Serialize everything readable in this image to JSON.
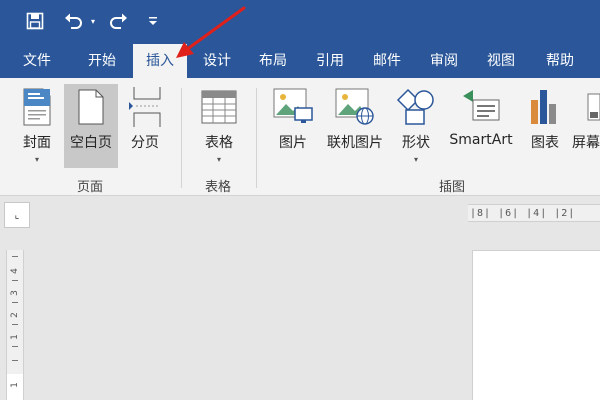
{
  "tabs": [
    {
      "label": "文件"
    },
    {
      "label": "开始"
    },
    {
      "label": "插入"
    },
    {
      "label": "设计"
    },
    {
      "label": "布局"
    },
    {
      "label": "引用"
    },
    {
      "label": "邮件"
    },
    {
      "label": "审阅"
    },
    {
      "label": "视图"
    },
    {
      "label": "帮助"
    }
  ],
  "active_tab": "插入",
  "ribbon": {
    "pages": {
      "group_label": "页面",
      "cover": "封面",
      "blank": "空白页",
      "break": "分页"
    },
    "tables": {
      "group_label": "表格",
      "table": "表格"
    },
    "illustrations": {
      "group_label": "插图",
      "picture": "图片",
      "online_picture": "联机图片",
      "shapes": "形状",
      "smartart": "SmartArt",
      "chart": "图表",
      "screenshot": "屏幕"
    }
  },
  "ruler": {
    "horizontal_text": "|8|  |6|  |4|  |2|",
    "vertical_numbers": [
      "4",
      "3",
      "2",
      "1",
      "1"
    ],
    "corner_glyph": "⌞"
  },
  "colors": {
    "accent": "#2b579a",
    "ribbon_bg": "#f3f3f3",
    "arrow": "#e0201a"
  }
}
